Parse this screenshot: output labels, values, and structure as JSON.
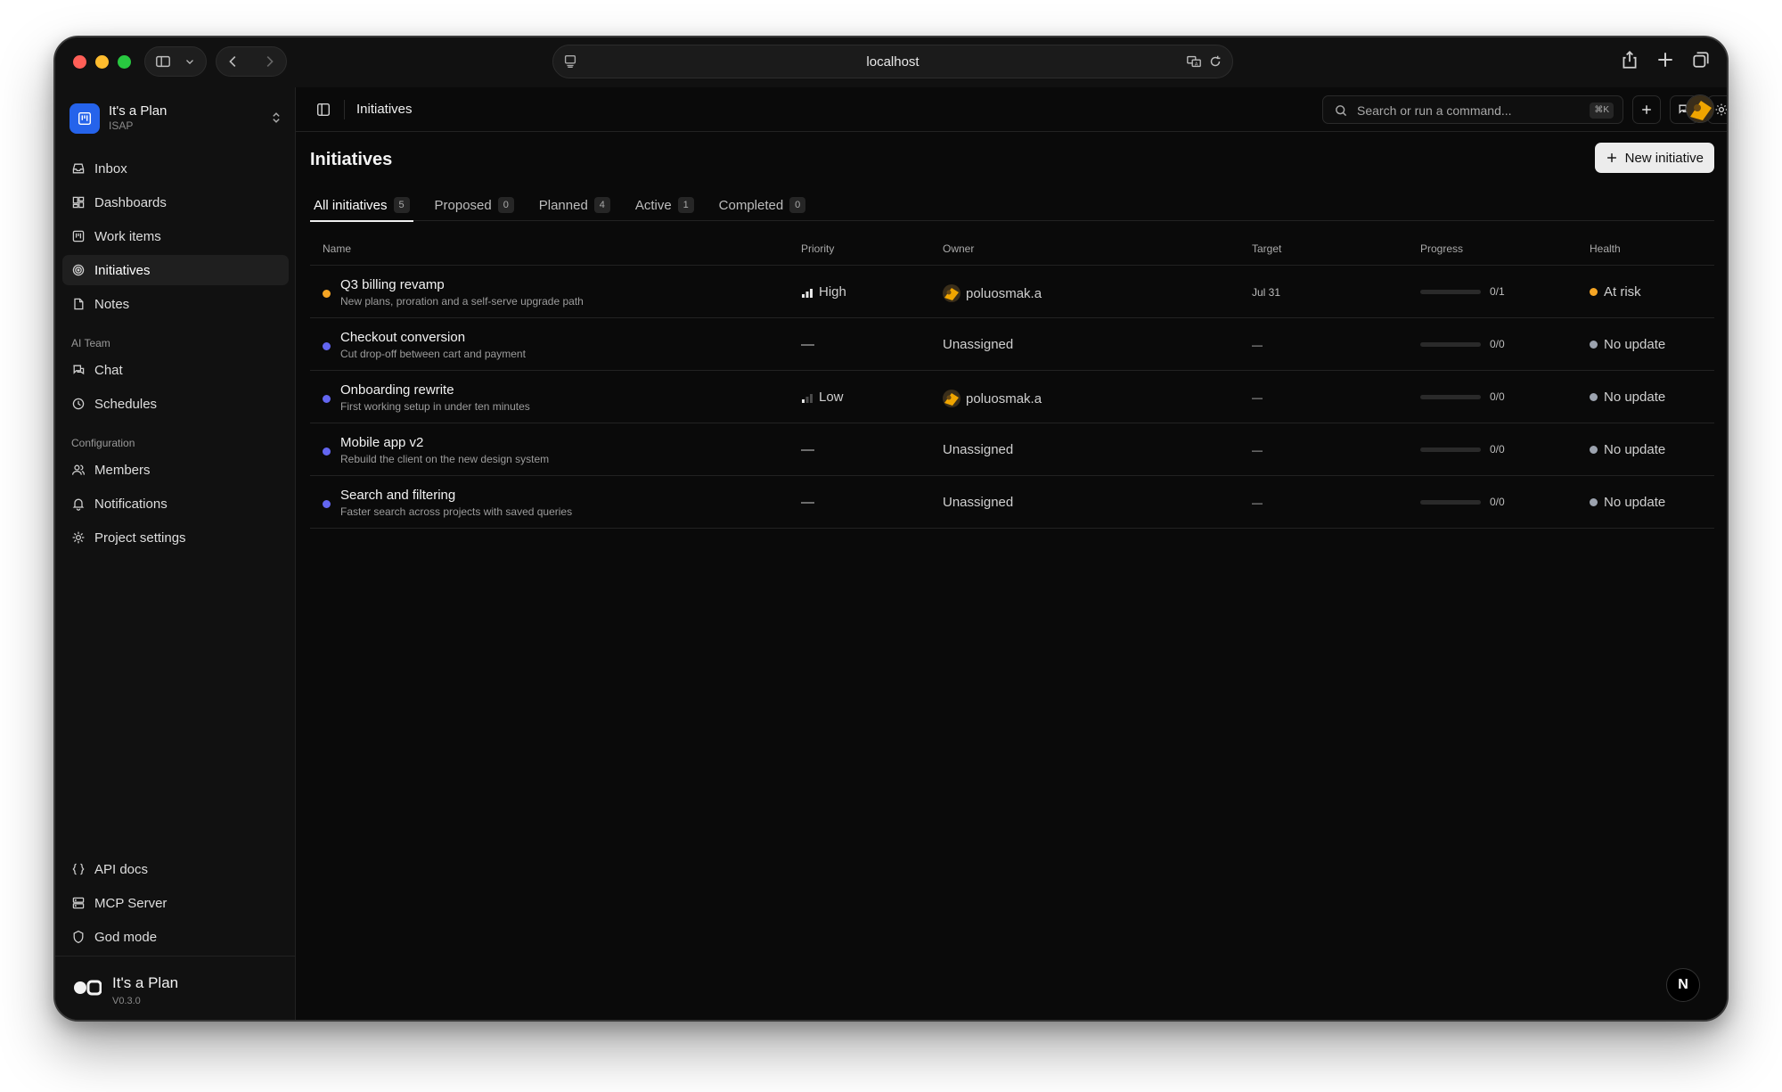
{
  "browser": {
    "url": "localhost"
  },
  "workspace": {
    "name": "It's a Plan",
    "key": "ISAP"
  },
  "sidebar": {
    "main": [
      {
        "label": "Inbox",
        "icon": "inbox-icon"
      },
      {
        "label": "Dashboards",
        "icon": "dashboard-icon"
      },
      {
        "label": "Work items",
        "icon": "kanban-icon"
      },
      {
        "label": "Initiatives",
        "icon": "target-icon",
        "active": true
      },
      {
        "label": "Notes",
        "icon": "note-icon"
      }
    ],
    "ai_section": "AI Team",
    "ai": [
      {
        "label": "Chat",
        "icon": "chat-icon"
      },
      {
        "label": "Schedules",
        "icon": "clock-icon"
      }
    ],
    "config_section": "Configuration",
    "config": [
      {
        "label": "Members",
        "icon": "users-icon"
      },
      {
        "label": "Notifications",
        "icon": "bell-icon"
      },
      {
        "label": "Project settings",
        "icon": "gear-icon"
      }
    ],
    "bottom": [
      {
        "label": "API docs",
        "icon": "braces-icon"
      },
      {
        "label": "MCP Server",
        "icon": "server-icon"
      },
      {
        "label": "God mode",
        "icon": "shield-icon"
      }
    ],
    "footer": {
      "brand": "It's a Plan",
      "version": "V0.3.0"
    }
  },
  "topbar": {
    "title": "Initiatives",
    "search_placeholder": "Search or run a command...",
    "search_shortcut": "⌘K"
  },
  "page": {
    "title": "Initiatives",
    "new_button": "New initiative",
    "tabs": [
      {
        "label": "All initiatives",
        "count": "5",
        "active": true
      },
      {
        "label": "Proposed",
        "count": "0"
      },
      {
        "label": "Planned",
        "count": "4"
      },
      {
        "label": "Active",
        "count": "1"
      },
      {
        "label": "Completed",
        "count": "0"
      }
    ],
    "columns": {
      "name": "Name",
      "priority": "Priority",
      "owner": "Owner",
      "target": "Target",
      "progress": "Progress",
      "health": "Health"
    },
    "rows": [
      {
        "title": "Q3 billing revamp",
        "desc": "New plans, proration and a self-serve upgrade path",
        "status_color": "#f5a524",
        "priority": "High",
        "priority_level": "high",
        "owner": "poluosmak.a",
        "has_avatar": true,
        "target": "Jul 31",
        "progress": "0/1",
        "progress_fraction": 0,
        "health": "At risk",
        "health_color": "#f5a524"
      },
      {
        "title": "Checkout conversion",
        "desc": "Cut drop-off between cart and payment",
        "status_color": "#6366f1",
        "priority": "—",
        "priority_level": "none",
        "owner": "Unassigned",
        "has_avatar": false,
        "target": "—",
        "progress": "0/0",
        "progress_fraction": 0,
        "health": "No update",
        "health_color": "#9ca3af"
      },
      {
        "title": "Onboarding rewrite",
        "desc": "First working setup in under ten minutes",
        "status_color": "#6366f1",
        "priority": "Low",
        "priority_level": "low",
        "owner": "poluosmak.a",
        "has_avatar": true,
        "target": "—",
        "progress": "0/0",
        "progress_fraction": 0,
        "health": "No update",
        "health_color": "#9ca3af"
      },
      {
        "title": "Mobile app v2",
        "desc": "Rebuild the client on the new design system",
        "status_color": "#6366f1",
        "priority": "—",
        "priority_level": "none",
        "owner": "Unassigned",
        "has_avatar": false,
        "target": "—",
        "progress": "0/0",
        "progress_fraction": 0,
        "health": "No update",
        "health_color": "#9ca3af"
      },
      {
        "title": "Search and filtering",
        "desc": "Faster search across projects with saved queries",
        "status_color": "#6366f1",
        "priority": "—",
        "priority_level": "none",
        "owner": "Unassigned",
        "has_avatar": false,
        "target": "—",
        "progress": "0/0",
        "progress_fraction": 0,
        "health": "No update",
        "health_color": "#9ca3af"
      }
    ]
  },
  "fab_label": "N"
}
